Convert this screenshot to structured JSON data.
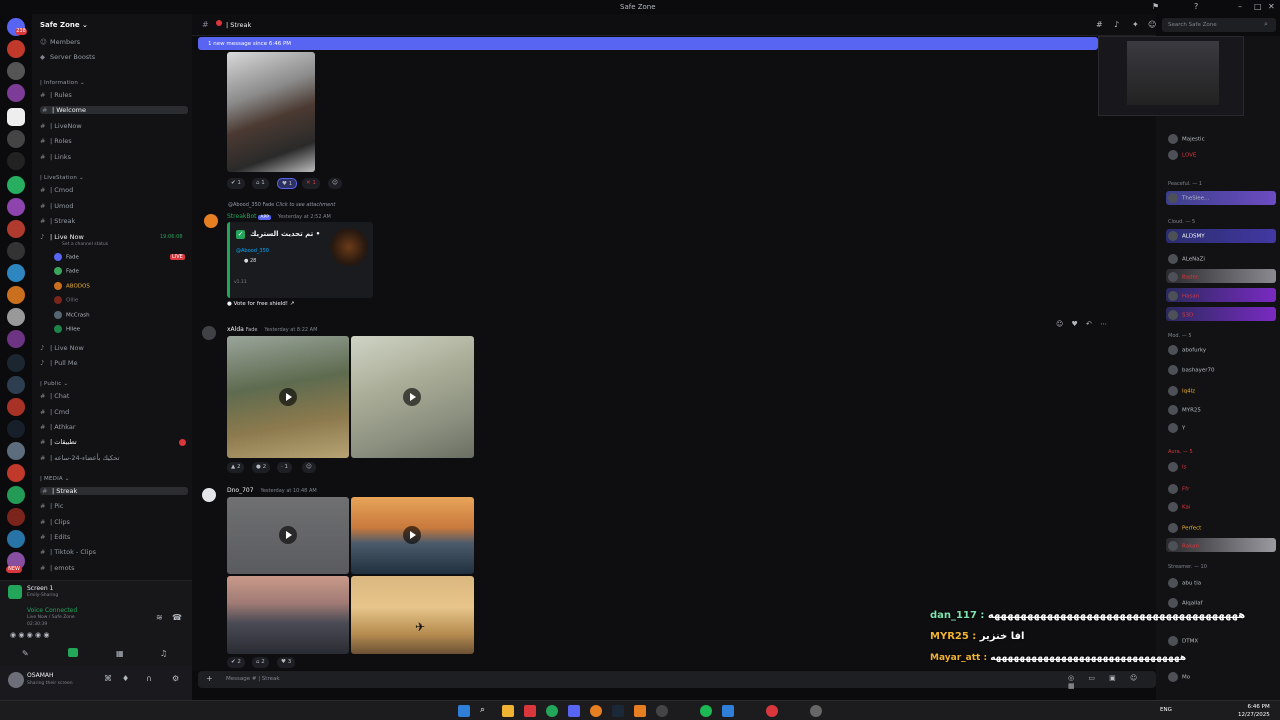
{
  "window": {
    "title": "Safe Zone"
  },
  "server": {
    "name": "Safe Zone",
    "top_links": [
      "Members",
      "Server Boosts"
    ]
  },
  "server_badges": [
    "238",
    "2",
    "NEW"
  ],
  "categories": {
    "information": "Information",
    "livestation": "LiveStation",
    "public": "Public",
    "media": "MEDIA"
  },
  "channels_info": [
    "Rules",
    "Welcome",
    "LiveNow",
    "Roles",
    "Links"
  ],
  "channels_live": [
    "Cmod",
    "Umod",
    "Streak"
  ],
  "voice_channel": {
    "name": "Live Now",
    "status": "Set a channel status",
    "time": "19:06:08",
    "live_badge": "LIVE"
  },
  "voice_users": [
    "Fade",
    "Fade",
    "ABODOS",
    "Ollie",
    "McCrash",
    "Hllee"
  ],
  "voice_extra": [
    "Live Now",
    "Pull Me"
  ],
  "channels_public": [
    "Chat",
    "Cmd",
    "Athkar",
    "تطبيقات",
    "تحكيك بأعضاء-24-ساعه"
  ],
  "channels_media": [
    "Streak",
    "Pic",
    "Clips",
    "Edits",
    "Tiktok - Clips",
    "emots"
  ],
  "screen_share": {
    "title": "Screen 1",
    "sub": "Emily-Sharing"
  },
  "voice_status": {
    "label": "Voice Connected",
    "location": "Live Now / Safe Zone",
    "time": "02:30:39"
  },
  "user": {
    "name": "OSAMAH",
    "status": "Sharing their screen"
  },
  "header": {
    "channel": "Streak"
  },
  "new_message_bar": "1 new message since 6:46 PM",
  "search": {
    "placeholder": "Search Safe Zone"
  },
  "messages": [
    {
      "reactions": [
        "1",
        "1",
        "1",
        "1"
      ]
    },
    {
      "reply_author": "@Abood_350",
      "reply_tag": "Fade",
      "reply_text": "Click to see attachment",
      "author": "StreakBot",
      "app": "APP",
      "ts": "Yesterday at 2:52 AM",
      "embed_title": "تم تحديث الستريك •",
      "embed_user": "@Abood_350",
      "embed_count": "28",
      "embed_footer": "v1.11",
      "button": "Vote for free shield!"
    },
    {
      "author": "xAlda",
      "tag": "Fade",
      "ts": "Yesterday at 8:22 AM",
      "reactions": [
        "2",
        "2",
        "1"
      ]
    },
    {
      "author": "Dno_707",
      "ts": "Yesterday at 10:48 AM",
      "reactions": [
        "2",
        "2",
        "3"
      ]
    }
  ],
  "composer": {
    "placeholder": "Message # | Streak"
  },
  "member_categories": [
    "Peaceful. — 1",
    "Cloud. — 5",
    "Mod. — 5",
    "Aura. — 5",
    "Streamer. — 10"
  ],
  "members": [
    "Majestic",
    "LOVE",
    "TheSlee...",
    "ALDSMY",
    "ALeNaZi",
    "Bader.",
    "Hasan",
    "S3D",
    "abofurky",
    "bashayer70",
    "Iq4lz",
    "MYR25",
    "Y",
    "Is",
    "Ffr",
    "Kai",
    "Perfect",
    "Rakan",
    "abu tia",
    "Alqallaf",
    "DTMX",
    "Mo"
  ],
  "overlay_chat": [
    {
      "user": "dan_117 :",
      "text": "ههههههههههههههههههههههههههههههههههههههه"
    },
    {
      "user": "MYR25 :",
      "text": "افا خنزير"
    },
    {
      "user": "Mayar_att :",
      "text": "ههههههههههههههههههههههههههههههههه"
    }
  ],
  "taskbar": {
    "lang": "ENG",
    "time": "6:46 PM",
    "date": "12/27/2025"
  }
}
